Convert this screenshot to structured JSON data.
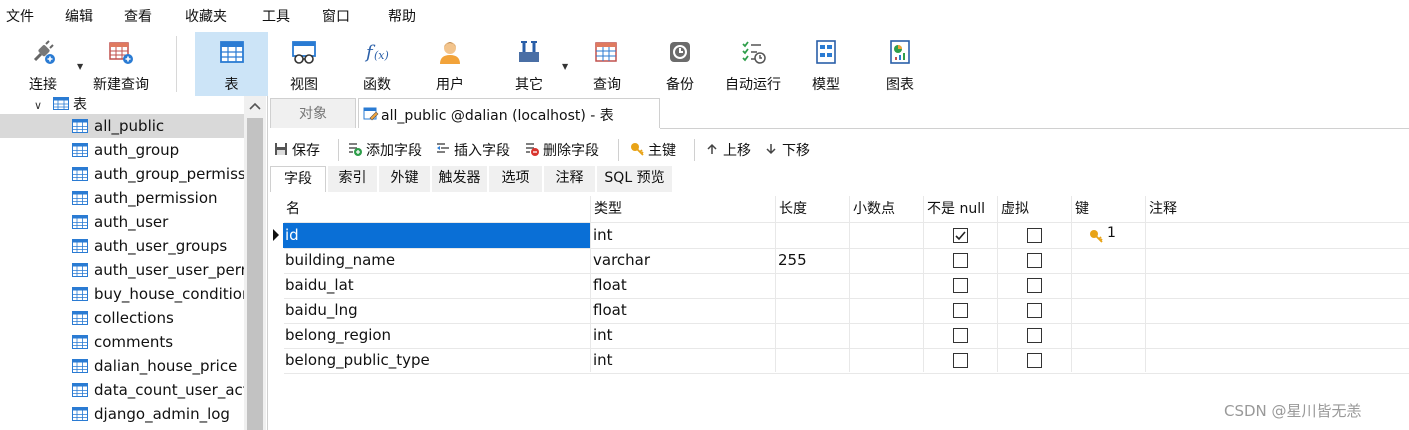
{
  "menu": [
    "文件",
    "编辑",
    "查看",
    "收藏夹",
    "工具",
    "窗口",
    "帮助"
  ],
  "toolbar": {
    "connect": "连接",
    "new_query": "新建查询",
    "table": "表",
    "view": "视图",
    "function": "函数",
    "user": "用户",
    "other": "其它",
    "query": "查询",
    "backup": "备份",
    "auto_run": "自动运行",
    "model": "模型",
    "chart": "图表"
  },
  "sidebar": {
    "group_label": "表",
    "items": [
      "all_public",
      "auth_group",
      "auth_group_permissi",
      "auth_permission",
      "auth_user",
      "auth_user_groups",
      "auth_user_user_perm",
      "buy_house_condition",
      "collections",
      "comments",
      "dalian_house_price",
      "data_count_user_acti",
      "django_admin_log"
    ]
  },
  "tabs": {
    "objects": "对象",
    "table_tab": "all_public @dalian (localhost) - 表"
  },
  "editor_toolbar": {
    "save": "保存",
    "add_field": "添加字段",
    "insert_field": "插入字段",
    "delete_field": "删除字段",
    "primary_key": "主键",
    "move_up": "上移",
    "move_down": "下移"
  },
  "editor_tabs": [
    "字段",
    "索引",
    "外键",
    "触发器",
    "选项",
    "注释",
    "SQL 预览"
  ],
  "grid": {
    "columns": [
      "名",
      "类型",
      "长度",
      "小数点",
      "不是 null",
      "虚拟",
      "键",
      "注释"
    ],
    "rows": [
      {
        "name": "id",
        "type": "int",
        "length": "",
        "not_null": true,
        "virtual": false,
        "key": "1"
      },
      {
        "name": "building_name",
        "type": "varchar",
        "length": "255",
        "not_null": false,
        "virtual": false,
        "key": ""
      },
      {
        "name": "baidu_lat",
        "type": "float",
        "length": "",
        "not_null": false,
        "virtual": false,
        "key": ""
      },
      {
        "name": "baidu_lng",
        "type": "float",
        "length": "",
        "not_null": false,
        "virtual": false,
        "key": ""
      },
      {
        "name": "belong_region",
        "type": "int",
        "length": "",
        "not_null": false,
        "virtual": false,
        "key": ""
      },
      {
        "name": "belong_public_type",
        "type": "int",
        "length": "",
        "not_null": false,
        "virtual": false,
        "key": ""
      }
    ]
  },
  "watermark": "CSDN @星川皆无恙",
  "colors": {
    "accent": "#0a6fd6",
    "active_tool": "#cce4f7",
    "selected_tree": "#d9d9d9"
  }
}
